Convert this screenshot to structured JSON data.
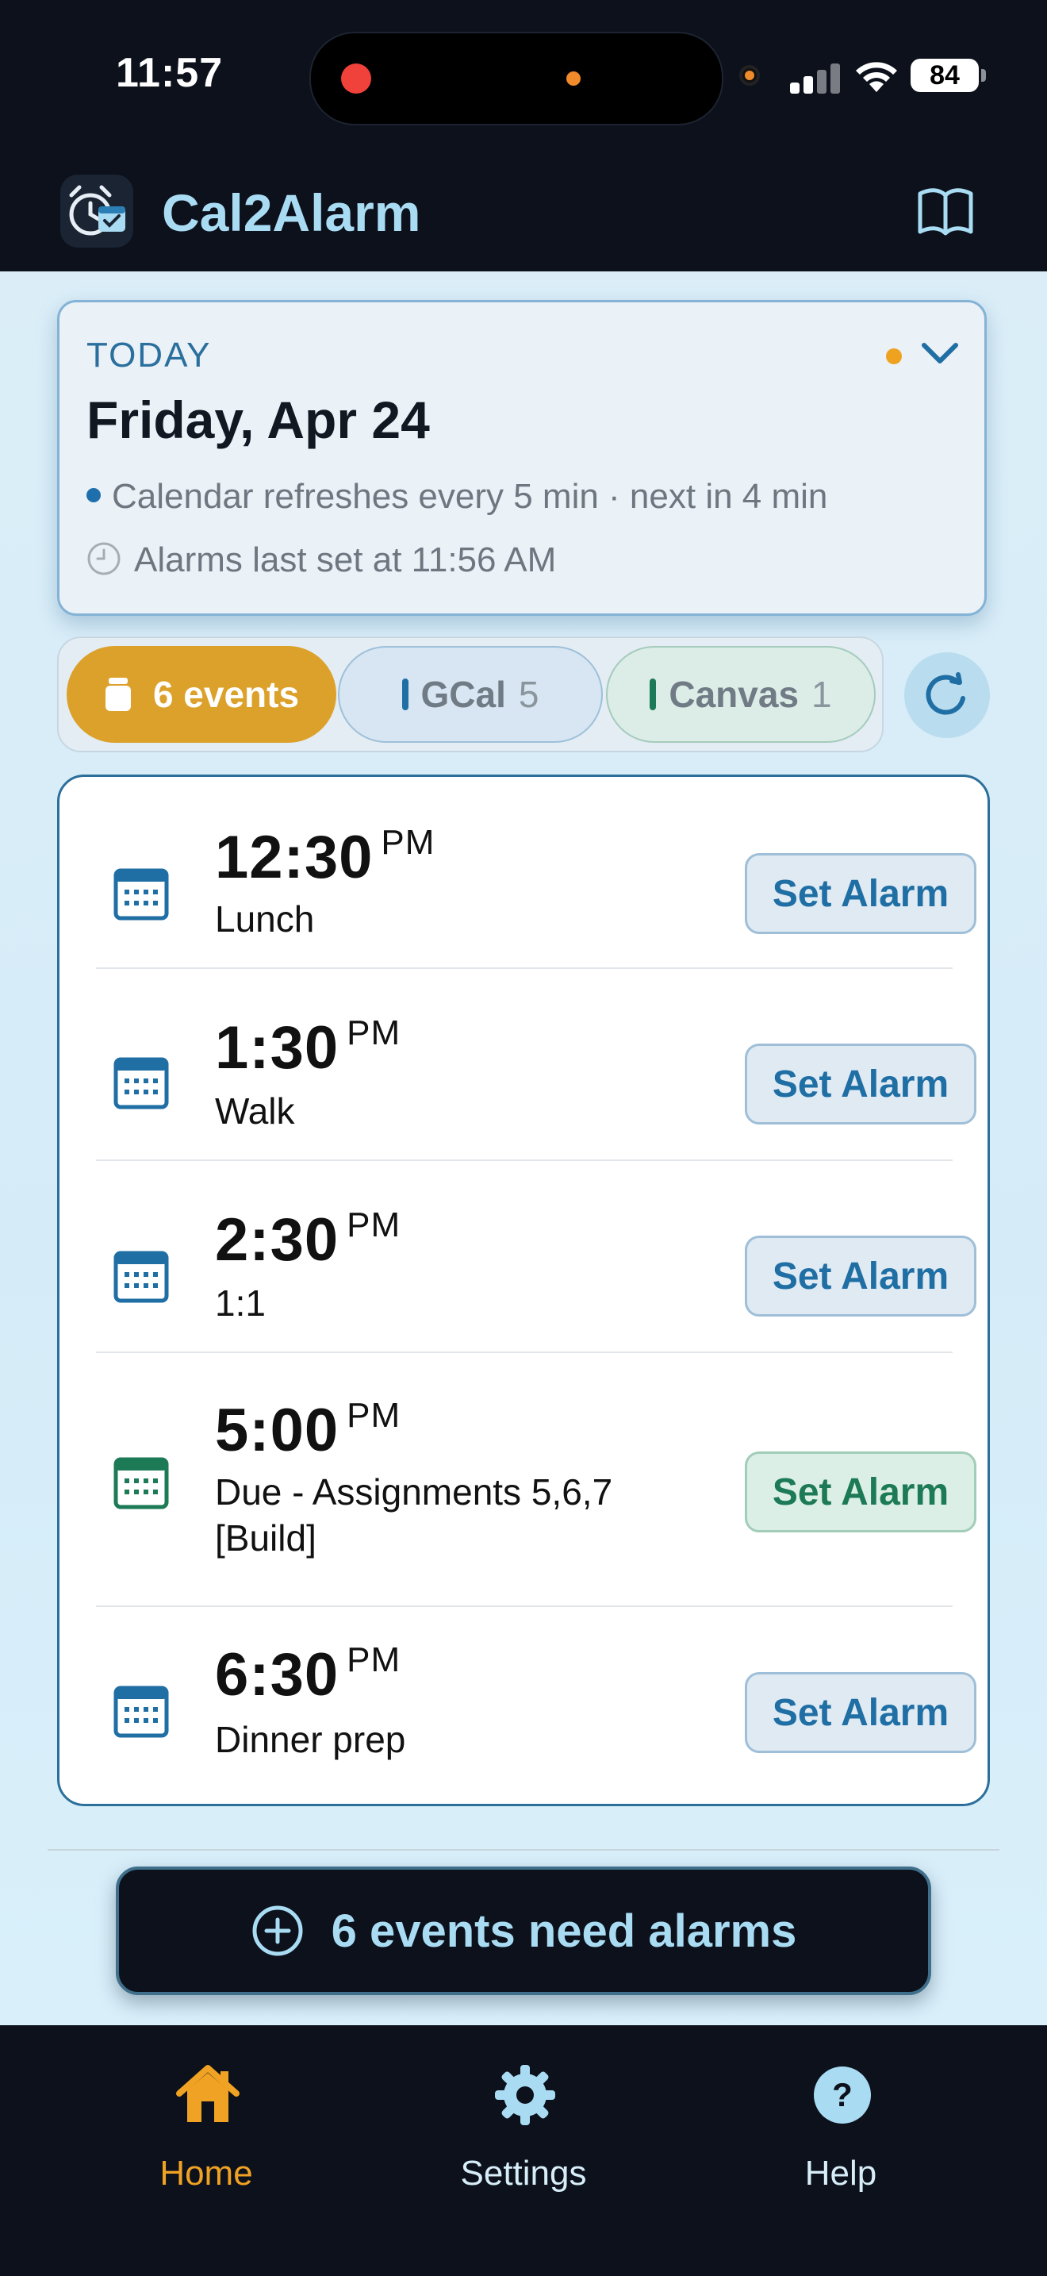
{
  "status_bar": {
    "time": "11:57",
    "battery": "84"
  },
  "header": {
    "title": "Cal2Alarm"
  },
  "today": {
    "label": "TODAY",
    "date": "Friday, Apr 24",
    "refresh_info": "Calendar refreshes every 5 min · next in 4 min",
    "alarms_info": "Alarms last set at 11:56 AM"
  },
  "filters": {
    "all": "6 events",
    "gcal": {
      "label": "GCal",
      "count": "5"
    },
    "canvas": {
      "label": "Canvas",
      "count": "1"
    }
  },
  "events": [
    {
      "time": "12:30",
      "ampm": "PM",
      "title": "Lunch",
      "action": "Set Alarm",
      "source": "gcal"
    },
    {
      "time": "1:30",
      "ampm": "PM",
      "title": "Walk",
      "action": "Set Alarm",
      "source": "gcal"
    },
    {
      "time": "2:30",
      "ampm": "PM",
      "title": "1:1",
      "action": "Set Alarm",
      "source": "gcal"
    },
    {
      "time": "5:00",
      "ampm": "PM",
      "title": "Due - Assignments 5,6,7 [Build]",
      "action": "Set Alarm",
      "source": "canvas"
    },
    {
      "time": "6:30",
      "ampm": "PM",
      "title": "Dinner prep",
      "action": "Set Alarm",
      "source": "gcal"
    }
  ],
  "need_alarms_label": "6 events need alarms",
  "tabs": {
    "home": "Home",
    "settings": "Settings",
    "help": "Help"
  },
  "colors": {
    "accent_gold": "#dca12b",
    "gcal_blue": "#1f6ea4",
    "canvas_green": "#1d7a56",
    "active_tab": "#efa223"
  }
}
